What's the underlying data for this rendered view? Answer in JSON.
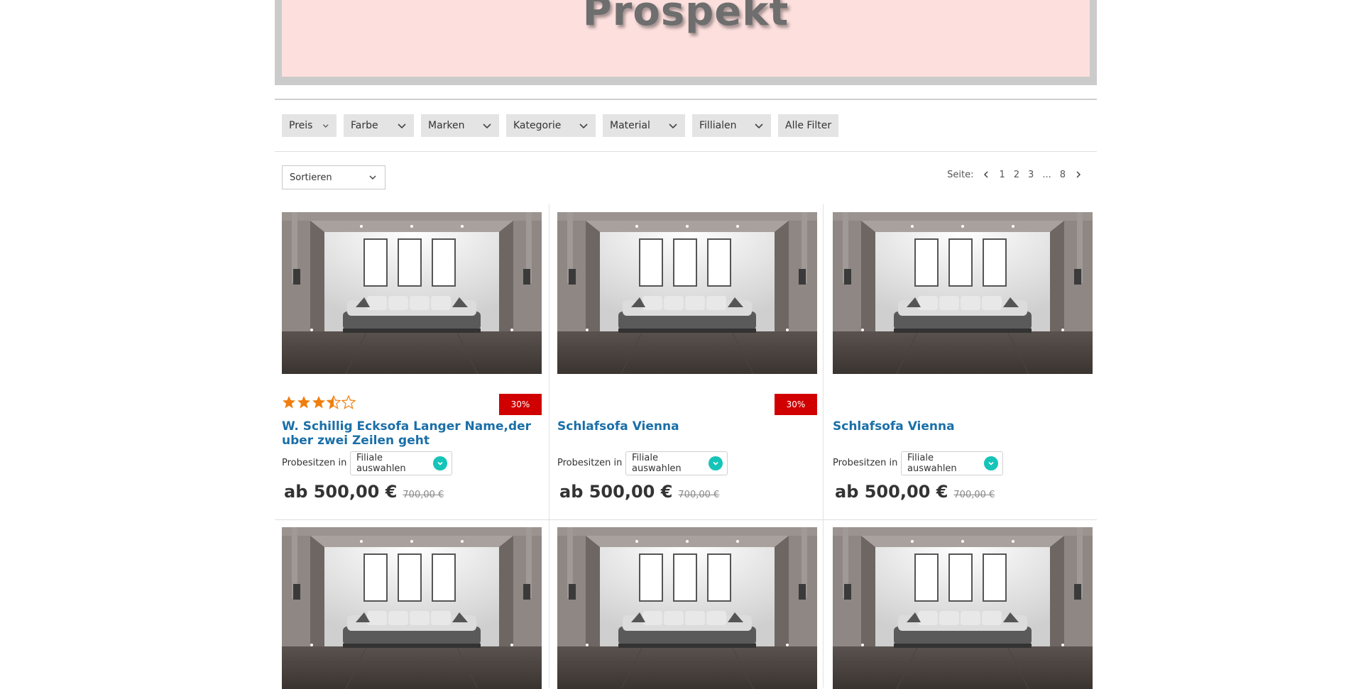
{
  "hero": {
    "title": "Prospekt"
  },
  "filters": [
    "Preis",
    "Farbe",
    "Marken",
    "Kategorie",
    "Material",
    "Fillialen"
  ],
  "all_filters_label": "Alle Filter",
  "sort": {
    "label": "Sortieren"
  },
  "pagination": {
    "label": "Seite:",
    "pages": [
      "1",
      "2",
      "3",
      "...",
      "8"
    ]
  },
  "products": [
    {
      "title": "W. Schillig Ecksofa Langer Name,der uber zwei Zeilen geht",
      "badge": "30%",
      "rating": 3.5,
      "probe_label": "Probesitzen in",
      "store_select": "Filiale auswahlen",
      "price": "ab 500,00 €",
      "old_price": "700,00 €"
    },
    {
      "title": "Schlafsofa Vienna",
      "badge": "30%",
      "probe_label": "Probesitzen in",
      "store_select": "Filiale auswahlen",
      "price": "ab 500,00 €",
      "old_price": "700,00 €"
    },
    {
      "title": "Schlafsofa Vienna",
      "probe_label": "Probesitzen in",
      "store_select": "Filiale auswahlen",
      "price": "ab 500,00 €",
      "old_price": "700,00 €"
    }
  ],
  "colors": {
    "accent_blue": "#1a6fa8",
    "badge_red": "#d10000",
    "teal": "#16c4b8",
    "star_orange": "#f07e0f",
    "hero_pink": "#fde0de"
  }
}
